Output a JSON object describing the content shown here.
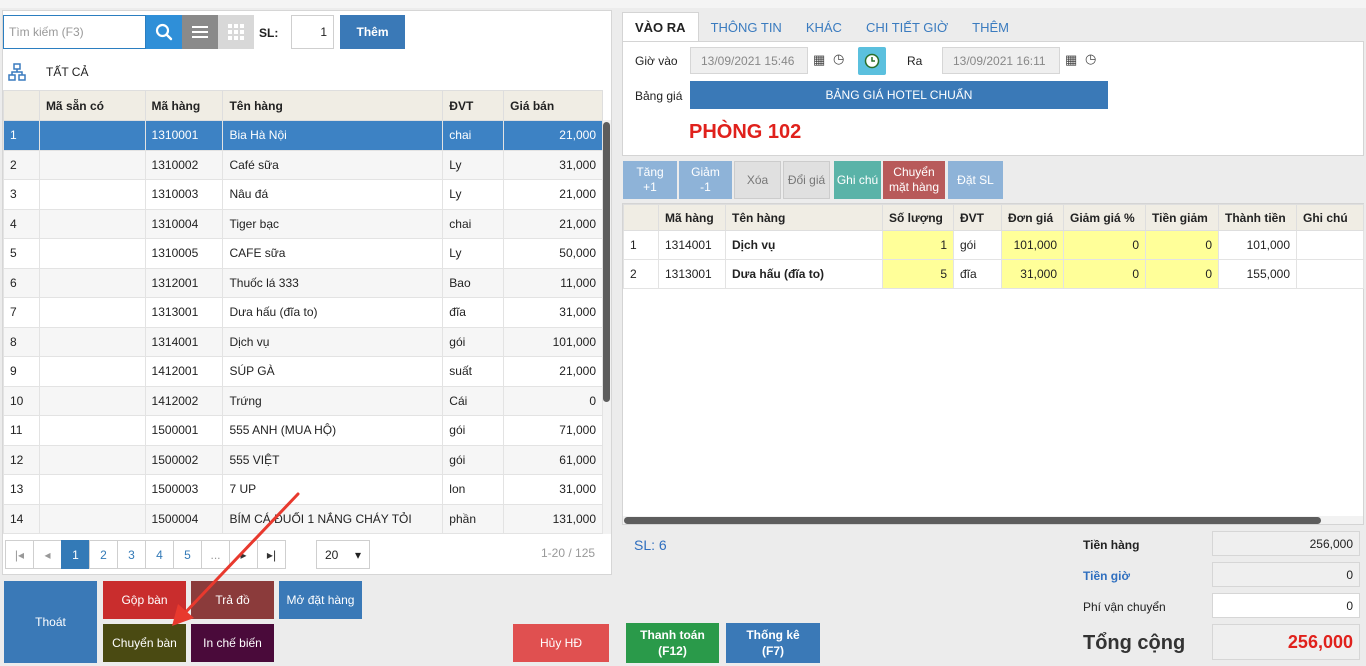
{
  "search": {
    "placeholder": "Tìm kiếm (F3)",
    "sl_label": "SL:",
    "sl_value": "1",
    "add_label": "Thêm"
  },
  "category": {
    "all_label": "TẤT CẢ"
  },
  "product_table": {
    "headers": [
      "",
      "Mã sẵn có",
      "Mã hàng",
      "Tên hàng",
      "ĐVT",
      "Giá bán"
    ],
    "rows": [
      [
        "1",
        "",
        "1310001",
        "Bia Hà Nội",
        "chai",
        "21,000"
      ],
      [
        "2",
        "",
        "1310002",
        "Café sữa",
        "Ly",
        "31,000"
      ],
      [
        "3",
        "",
        "1310003",
        "Nâu đá",
        "Ly",
        "21,000"
      ],
      [
        "4",
        "",
        "1310004",
        "Tiger bạc",
        "chai",
        "21,000"
      ],
      [
        "5",
        "",
        "1310005",
        "CAFE sữa",
        "Ly",
        "50,000"
      ],
      [
        "6",
        "",
        "1312001",
        "Thuốc lá 333",
        "Bao",
        "11,000"
      ],
      [
        "7",
        "",
        "1313001",
        "Dưa hấu (đĩa to)",
        "đĩa",
        "31,000"
      ],
      [
        "8",
        "",
        "1314001",
        "Dịch vụ",
        "gói",
        "101,000"
      ],
      [
        "9",
        "",
        "1412001",
        "SÚP GÀ",
        "suất",
        "21,000"
      ],
      [
        "10",
        "",
        "1412002",
        "Trứng",
        "Cái",
        "0"
      ],
      [
        "11",
        "",
        "1500001",
        "555 ANH (MUA HỘ)",
        "gói",
        "71,000"
      ],
      [
        "12",
        "",
        "1500002",
        "555 VIỆT",
        "gói",
        "61,000"
      ],
      [
        "13",
        "",
        "1500003",
        "7 UP",
        "lon",
        "31,000"
      ],
      [
        "14",
        "",
        "1500004",
        "BÍM CÁ ĐUỐI 1 NẮNG CHÁY TỎI",
        "phần",
        "131,000"
      ]
    ]
  },
  "pager": {
    "pages": [
      "1",
      "2",
      "3",
      "4",
      "5",
      "..."
    ],
    "page_size": "20",
    "info": "1-20 / 125"
  },
  "left_actions": {
    "exit": "Thoát",
    "merge": "Gộp bàn",
    "return": "Trả đồ",
    "open_order": "Mở đặt hàng",
    "move_table": "Chuyển bàn",
    "print_kitchen": "In chế biến",
    "cancel": "Hủy HĐ"
  },
  "tabs": [
    "VÀO RA",
    "THÔNG TIN",
    "KHÁC",
    "CHI TIẾT GIỜ",
    "THÊM"
  ],
  "checkin": {
    "in_label": "Giờ vào",
    "in_value": "13/09/2021 15:46",
    "out_label": "Ra",
    "out_value": "13/09/2021 16:11",
    "price_label": "Bảng giá",
    "price_list": "BẢNG GIÁ HOTEL CHUẨN",
    "room": "PHÒNG 102"
  },
  "toolbar": {
    "inc": [
      "Tăng",
      "+1"
    ],
    "dec": [
      "Giảm",
      "-1"
    ],
    "delete": "Xóa",
    "change_price": "Đổi giá",
    "note": "Ghi chú",
    "move_item": [
      "Chuyển",
      "mặt hàng"
    ],
    "set_qty": "Đặt SL"
  },
  "order_table": {
    "headers": [
      "",
      "Mã hàng",
      "Tên hàng",
      "Số lượng",
      "ĐVT",
      "Đơn giá",
      "Giảm giá %",
      "Tiền giảm",
      "Thành tiền",
      "Ghi chú"
    ],
    "rows": [
      [
        "1",
        "1314001",
        "Dịch vụ",
        "1",
        "gói",
        "101,000",
        "0",
        "0",
        "101,000",
        ""
      ],
      [
        "2",
        "1313001",
        "Dưa hấu (đĩa to)",
        "5",
        "đĩa",
        "31,000",
        "0",
        "0",
        "155,000",
        ""
      ]
    ]
  },
  "summary": {
    "sl": "SL: 6",
    "goods_label": "Tiền hàng",
    "goods_value": "256,000",
    "hours_label": "Tiền giờ",
    "hours_value": "0",
    "ship_label": "Phí vận chuyển",
    "ship_value": "0",
    "total_label": "Tổng cộng",
    "total_value": "256,000"
  },
  "footer": {
    "pay": [
      "Thanh toán",
      "(F12)"
    ],
    "stats": [
      "Thống kê",
      "(F7)"
    ]
  }
}
